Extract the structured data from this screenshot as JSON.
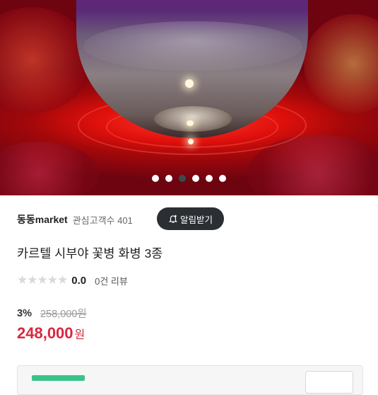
{
  "gallery": {
    "slide_count": 6,
    "active_index": 2,
    "image_alt": "clear glass vase on red background"
  },
  "seller": {
    "name": "동동market",
    "interest_label": "관심고객수 401",
    "alert_button": "알림받기"
  },
  "product": {
    "title": "카르텔 시부야 꽃병 화병 3종",
    "rating": {
      "stars_filled": 0,
      "stars_total": 5,
      "score": "0.0",
      "reviews": "0건 리뷰"
    },
    "discount": "3%",
    "original_price": "258,000원",
    "price": "248,000",
    "currency": "원"
  },
  "colors": {
    "accent_price": "#d8283f",
    "alert_button_bg": "#2b2f33",
    "active_dot": "#3d4a4e",
    "bottom_bar": "#39c38b"
  }
}
